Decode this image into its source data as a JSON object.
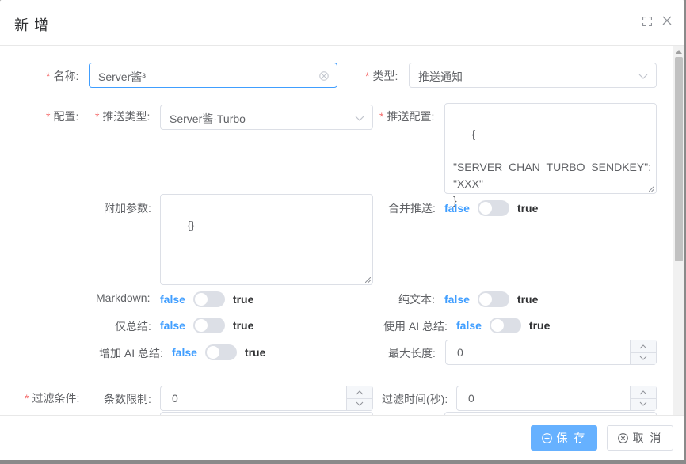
{
  "dialog": {
    "title": "新 增"
  },
  "form": {
    "name": {
      "label": "名称:",
      "value": "Server酱³"
    },
    "type": {
      "label": "类型:",
      "value": "推送通知"
    },
    "config": {
      "label": "配置:"
    },
    "push_type": {
      "label": "推送类型:",
      "value": "Server酱·Turbo"
    },
    "push_config": {
      "label": "推送配置:",
      "value": "{\n    \"SERVER_CHAN_TURBO_SENDKEY\": \"XXX\"\n}"
    },
    "extra_params": {
      "label": "附加参数:",
      "value": "{}"
    },
    "merge_push": {
      "label": "合并推送:",
      "false_text": "false",
      "true_text": "true",
      "on": false
    },
    "markdown": {
      "label": "Markdown:",
      "false_text": "false",
      "true_text": "true",
      "on": false
    },
    "plain_text": {
      "label": "纯文本:",
      "false_text": "false",
      "true_text": "true",
      "on": false
    },
    "summary_only": {
      "label": "仅总结:",
      "false_text": "false",
      "true_text": "true",
      "on": false
    },
    "use_ai_summary": {
      "label": "使用 AI 总结:",
      "false_text": "false",
      "true_text": "true",
      "on": false
    },
    "add_ai_summary": {
      "label": "增加 AI 总结:",
      "false_text": "false",
      "true_text": "true",
      "on": false
    },
    "max_length": {
      "label": "最大长度:",
      "value": "0"
    },
    "filter": {
      "label": "过滤条件:"
    },
    "count_limit": {
      "label": "条数限制:",
      "value": "0"
    },
    "filter_time": {
      "label": "过滤时间(秒):",
      "value": "0"
    }
  },
  "footer": {
    "save_label": "保 存",
    "cancel_label": "取 消"
  },
  "colors": {
    "primary": "#409eff",
    "primary_light": "#66b1ff",
    "required": "#f56c6c"
  }
}
